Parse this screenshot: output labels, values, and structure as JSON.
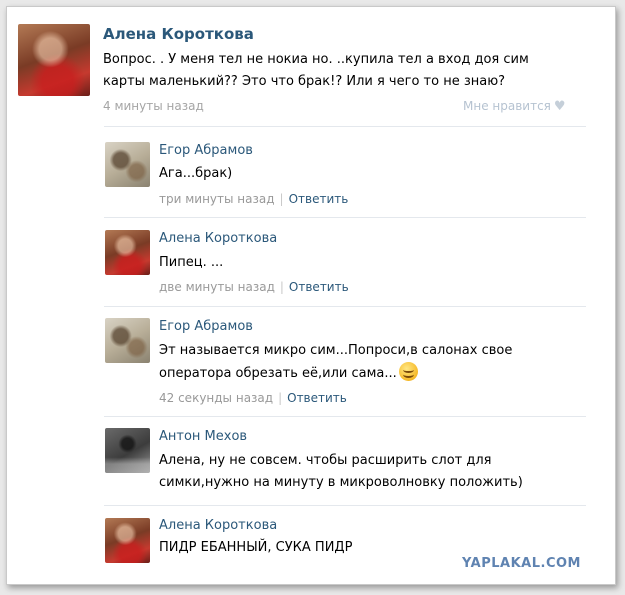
{
  "post": {
    "author": "Алена Короткова",
    "text_line1": "Вопрос. . У меня тел не нокиа но. ..купила тел а вход доя сим",
    "text_line2": "карты маленький?? Это что брак!? Или я чего то не знаю?",
    "time": "4 минуты назад",
    "like_label": "Мне нравится",
    "like_icon": "heart-icon"
  },
  "comments": [
    {
      "author": "Егор Абрамов",
      "line1": "Ага...брак)",
      "line2": "",
      "time": "три минуты назад",
      "reply": "Ответить"
    },
    {
      "author": "Алена Короткова",
      "line1": "Пипец. ...",
      "line2": "",
      "time": "две минуты назад",
      "reply": "Ответить"
    },
    {
      "author": "Егор Абрамов",
      "line1": "Эт называется микро сим...Попроси,в салонах свое",
      "line2": "оператора обрезать её,или сама...",
      "time": "42 секунды назад",
      "reply": "Ответить",
      "emoji": "smiley-icon"
    },
    {
      "author": "Антон Мехов",
      "line1": "Алена, ну не совсем. чтобы расширить слот для",
      "line2": "симки,нужно на минуту в микроволновку положить)",
      "time": "",
      "reply": ""
    },
    {
      "author": "Алена Короткова",
      "line1": "ПИДР ЕБАННЫЙ, СУКА ПИДР",
      "line2": "",
      "time": "",
      "reply": ""
    }
  ],
  "watermark": "YAPLAKAL.COM"
}
